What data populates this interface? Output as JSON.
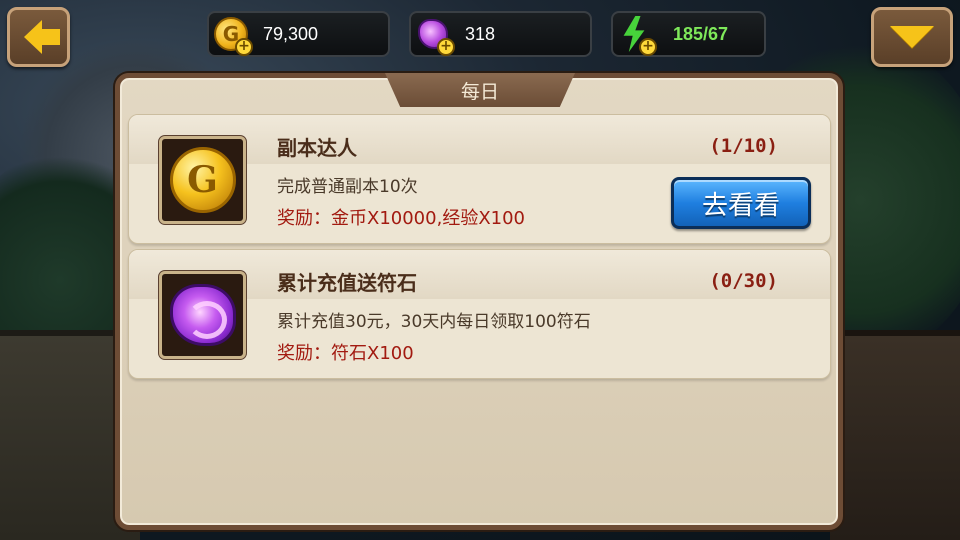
{
  "resources": {
    "gold": "79,300",
    "gems": "318",
    "energy": "185/67"
  },
  "panel": {
    "tab_label": "每日"
  },
  "tasks": [
    {
      "title": "副本达人",
      "progress": "(1/10)",
      "description": "完成普通副本10次",
      "reward": "奖励：金币X10000,经验X100",
      "icon": "gold-coin-icon",
      "action_label": "去看看"
    },
    {
      "title": "累计充值送符石",
      "progress": "(0/30)",
      "description": "累计充值30元，30天内每日领取100符石",
      "reward": "奖励：符石X100",
      "icon": "purple-gem-icon"
    }
  ],
  "colors": {
    "accent_gold": "#f6c319",
    "energy_text": "#7ee85a",
    "reward_text": "#a21a10",
    "button_blue": "#1f7fe0"
  }
}
